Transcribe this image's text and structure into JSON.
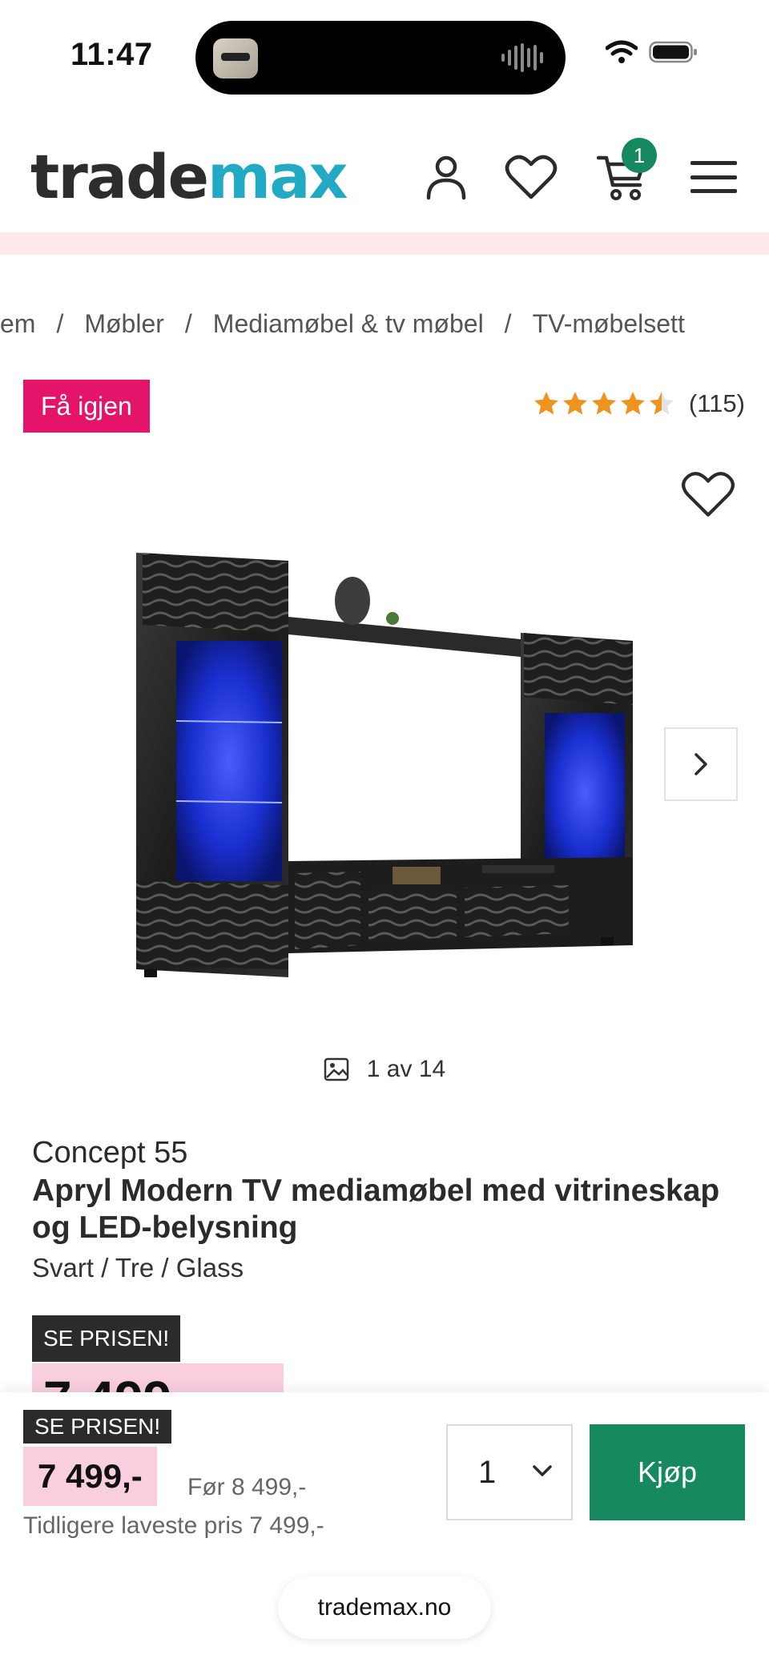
{
  "status_bar": {
    "time": "11:47"
  },
  "header": {
    "logo_part1": "trade",
    "logo_part2": "max",
    "cart_count": "1",
    "brand_color": "#22a9c4",
    "accent_green": "#168a5e"
  },
  "breadcrumb": [
    "em",
    "Møbler",
    "Mediamøbel & tv møbel",
    "TV-møbelsett"
  ],
  "badge": {
    "label": "Få igjen",
    "color": "#e4146b"
  },
  "rating": {
    "stars": 4.5,
    "max": 5,
    "count": "(115)",
    "star_color": "#f0921e"
  },
  "gallery": {
    "counter": "1 av 14",
    "current": 1,
    "total": 14
  },
  "product": {
    "brand": "Concept 55",
    "title": "Apryl Modern TV mediamøbel med vitrineskap og LED-belysning",
    "variant": "Svart / Tre / Glass",
    "price_label": "SE PRISEN!",
    "price_partial": "7 499"
  },
  "sticky": {
    "price_label": "SE PRISEN!",
    "price": "7 499,-",
    "before_price": "Før 8 499,-",
    "lowest_price": "Tidligere laveste pris 7 499,-",
    "quantity": "1",
    "buy_label": "Kjøp"
  },
  "browser": {
    "url": "trademax.no"
  },
  "icons": [
    "wifi-icon",
    "battery-icon",
    "user-icon",
    "heart-icon",
    "cart-icon",
    "menu-icon",
    "chevron-right-icon",
    "image-icon",
    "chevron-down-icon"
  ]
}
